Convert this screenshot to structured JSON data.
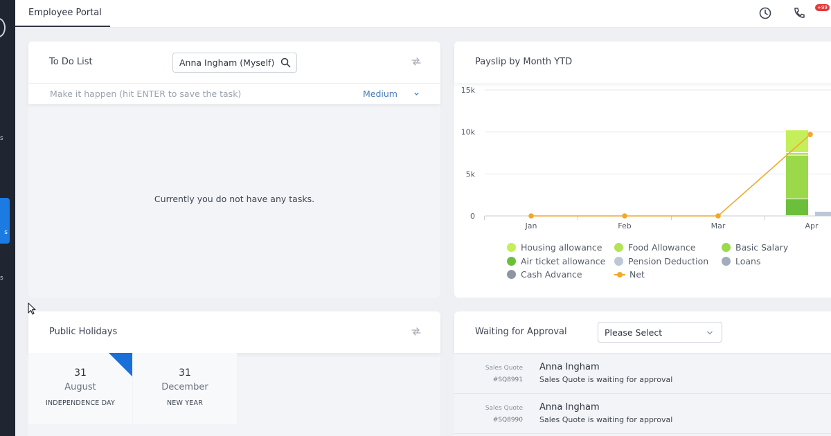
{
  "app": {
    "tab_label": "Employee Portal",
    "notification_badge": "+99"
  },
  "todo": {
    "title": "To Do List",
    "assignee_value": "Anna Ingham (Myself)",
    "task_placeholder": "Make it happen (hit ENTER to save the task)",
    "priority_value": "Medium",
    "empty_message": "Currently you do not have any tasks."
  },
  "payslip": {
    "title": "Payslip by Month YTD",
    "legend": [
      {
        "label": "Housing allowance",
        "color": "#c4ef5a"
      },
      {
        "label": "Food Allowance",
        "color": "#b4e356"
      },
      {
        "label": "Basic Salary",
        "color": "#9cd94a"
      },
      {
        "label": "Air ticket allowance",
        "color": "#6cbf3a"
      },
      {
        "label": "Pension Deduction",
        "color": "#bcc8d6"
      },
      {
        "label": "Loans",
        "color": "#a2adbc"
      },
      {
        "label": "Cash Advance",
        "color": "#8e96a3"
      },
      {
        "label": "Net",
        "color": "#f0a92c"
      }
    ]
  },
  "chart_data": {
    "type": "bar",
    "title": "Payslip by Month YTD",
    "categories": [
      "Jan",
      "Feb",
      "Mar",
      "Apr"
    ],
    "yticks": [
      "0",
      "5k",
      "10k",
      "15k"
    ],
    "ylim": [
      0,
      15000
    ],
    "stacked": true,
    "series": [
      {
        "name": "Air ticket allowance",
        "color": "#6cbf3a",
        "values": [
          0,
          0,
          0,
          2000
        ]
      },
      {
        "name": "Basic Salary",
        "color": "#9cd94a",
        "values": [
          0,
          0,
          0,
          5200
        ]
      },
      {
        "name": "Food Allowance",
        "color": "#b4e356",
        "values": [
          0,
          0,
          0,
          300
        ]
      },
      {
        "name": "Housing allowance",
        "color": "#c4ef5a",
        "values": [
          0,
          0,
          0,
          2700
        ]
      },
      {
        "name": "Pension Deduction",
        "color": "#bcc8d6",
        "values": [
          0,
          0,
          0,
          500
        ]
      },
      {
        "name": "Net",
        "type": "line",
        "color": "#f0a92c",
        "values": [
          0,
          0,
          0,
          9700
        ]
      }
    ]
  },
  "holidays": {
    "title": "Public Holidays",
    "items": [
      {
        "day": "31",
        "month": "August",
        "name": "INDEPENDENCE DAY"
      },
      {
        "day": "31",
        "month": "December",
        "name": "NEW YEAR"
      }
    ]
  },
  "approval": {
    "title": "Waiting for Approval",
    "select_value": "Please Select",
    "rows": [
      {
        "kind": "Sales Quote",
        "number": "#SQ8991",
        "who": "Anna Ingham",
        "message": "Sales Quote is waiting for approval"
      },
      {
        "kind": "Sales Quote",
        "number": "#SQ8990",
        "who": "Anna Ingham",
        "message": "Sales Quote is waiting for approval"
      }
    ]
  }
}
